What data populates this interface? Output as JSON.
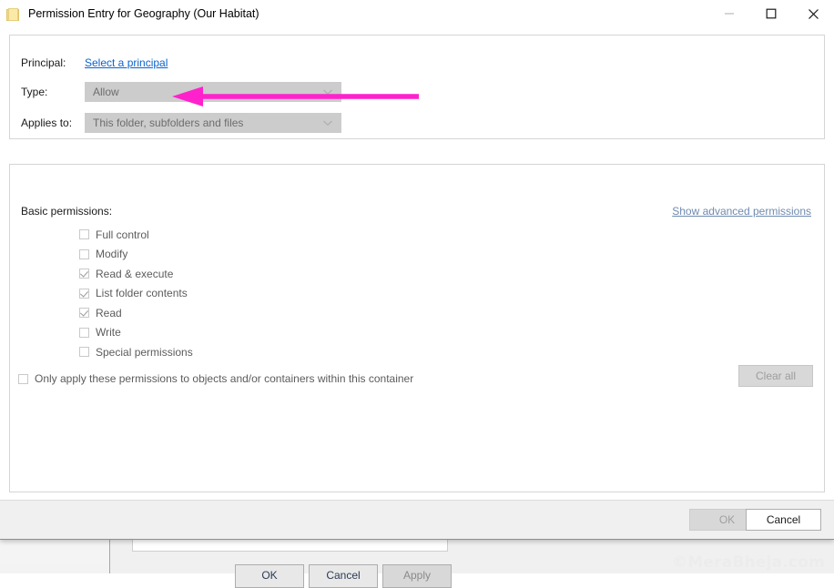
{
  "window": {
    "title": "Permission Entry for Geography (Our Habitat)",
    "icon": "folder-icon",
    "controls": {
      "minimize": "minimize-icon",
      "maximize": "maximize-icon",
      "close": "close-icon"
    }
  },
  "form": {
    "principal_label": "Principal:",
    "principal_link": "Select a principal",
    "type_label": "Type:",
    "type_value": "Allow",
    "applies_label": "Applies to:",
    "applies_value": "This folder, subfolders and files"
  },
  "permissions": {
    "section_label": "Basic permissions:",
    "advanced_link": "Show advanced permissions",
    "items": [
      {
        "label": "Full control",
        "checked": false
      },
      {
        "label": "Modify",
        "checked": false
      },
      {
        "label": "Read & execute",
        "checked": true
      },
      {
        "label": "List folder contents",
        "checked": true
      },
      {
        "label": "Read",
        "checked": true
      },
      {
        "label": "Write",
        "checked": false
      },
      {
        "label": "Special permissions",
        "checked": false
      }
    ],
    "only_apply_label": "Only apply these permissions to objects and/or containers within this container",
    "only_apply_checked": false,
    "clear_all_label": "Clear all"
  },
  "footer": {
    "ok_label": "OK",
    "cancel_label": "Cancel"
  },
  "background": {
    "ok_label": "OK",
    "cancel_label": "Cancel",
    "apply_label": "Apply"
  },
  "watermark": "©MeraBheja.com",
  "annotation": {
    "type": "arrow",
    "color": "#FF22CC",
    "points_to": "Select a principal",
    "direction": "left"
  },
  "colors": {
    "link": "#0b63ce",
    "muted_link": "#6f8bb0",
    "annotation": "#FF22CC",
    "disabled_fill": "#cccccc",
    "window_bg": "#ffffff",
    "footer_bg": "#f0f0f0"
  }
}
